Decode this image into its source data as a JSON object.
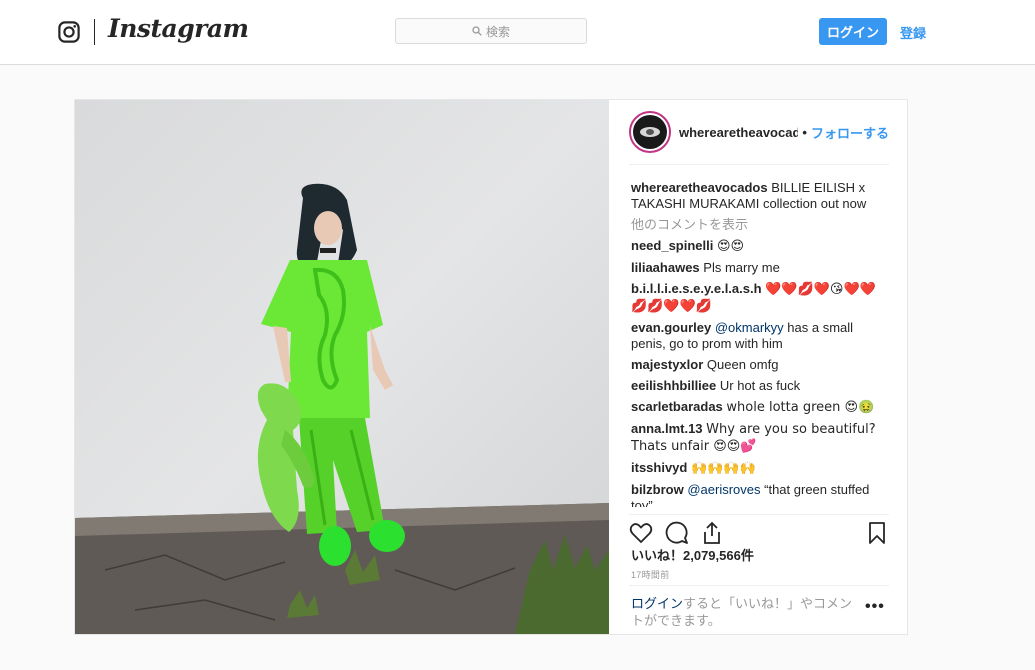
{
  "header": {
    "wordmark": "Instagram",
    "search_placeholder": "検索",
    "login_label": "ログイン",
    "signup_label": "登録",
    "accent_color": "#3897f0"
  },
  "post": {
    "username": "wherearetheavocados",
    "follow_label": "フォローする",
    "caption_user": "wherearetheavocados",
    "caption_text": "BILLIE EILISH x TAKASHI MURAKAMI collection out now",
    "more_comments": "他のコメントを表示",
    "comments": [
      {
        "user": "need_spinelli",
        "pre": "",
        "mention": "",
        "text": "😍😍"
      },
      {
        "user": "liliaahawes",
        "pre": "",
        "mention": "",
        "text": "Pls marry me"
      },
      {
        "user": "b.i.l.l.i.e.s.e.y.e.l.a.s.h",
        "pre": "",
        "mention": "",
        "text": "❤️❤️💋❤️😘❤️❤️💋💋❤️❤️💋"
      },
      {
        "user": "evan.gourley",
        "pre": "",
        "mention": "@okmarkyy",
        "text": "has a small penis, go to prom with him"
      },
      {
        "user": "majestyxlor",
        "pre": "",
        "mention": "",
        "text": "Queen omfg"
      },
      {
        "user": "eeilishhbilliee",
        "pre": "",
        "mention": "",
        "text": "Ur hot as fuck"
      },
      {
        "user": "scarletbaradas",
        "pre": "",
        "mention": "",
        "text": "whole lotta green 😍🤢"
      },
      {
        "user": "anna.lmt.13",
        "pre": "",
        "mention": "",
        "text": "Why are you so beautiful? Thats unfair 😍😍💕"
      },
      {
        "user": "itsshivyd",
        "pre": "",
        "mention": "",
        "text": "🙌🙌🙌🙌"
      },
      {
        "user": "bilzbrow",
        "pre": "",
        "mention": "@aerisroves",
        "text": "“that green stuffed toy”"
      }
    ],
    "likes": "いいね！2,079,566件",
    "timestamp": "17時間前",
    "login_prompt_link": "ログイン",
    "login_prompt_text": "すると「いいね！」やコメントができます。",
    "options_label": "•••"
  },
  "icons": [
    "instagram-glyph-icon",
    "search-icon",
    "heart-icon",
    "comment-icon",
    "share-icon",
    "bookmark-icon",
    "more-options-icon"
  ]
}
